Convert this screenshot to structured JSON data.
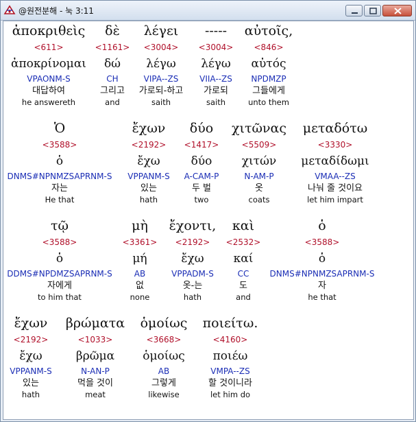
{
  "window": {
    "title": "@원전분해 - 눅 3:11"
  },
  "colors": {
    "strong": "#b0102a",
    "morph": "#1a2db5",
    "text": "#111111"
  },
  "rows": [
    {
      "words": [
        {
          "greek": "ἀποκριθεὶς",
          "strong": "<611>",
          "lemma": "ἀποκρίνομαι",
          "morph": "VPAONM-S",
          "korean": "대답하여",
          "english": "he answereth"
        },
        {
          "greek": "δὲ",
          "strong": "<1161>",
          "lemma": "δώ",
          "morph": "CH",
          "korean": "그리고",
          "english": "and"
        },
        {
          "greek": "λέγει",
          "strong": "<3004>",
          "lemma": "λέγω",
          "morph": "VIPA--ZS",
          "korean": "가로되-하고",
          "english": "saith"
        },
        {
          "greek": "-----",
          "strong": "<3004>",
          "lemma": "λέγω",
          "morph": "VIIA--ZS",
          "korean": "가로되",
          "english": "saith"
        },
        {
          "greek": "αὐτοῖς,",
          "strong": "<846>",
          "lemma": "αὐτός",
          "morph": "NPDMZP",
          "korean": "그들에게",
          "english": "unto them"
        }
      ]
    },
    {
      "words": [
        {
          "greek": "Ὁ",
          "strong": "<3588>",
          "lemma": "ὁ",
          "morph": "DNMS#NPNMZSAPRNM-S",
          "korean": "자는",
          "english": "He that"
        },
        {
          "greek": "ἔχων",
          "strong": "<2192>",
          "lemma": "ἔχω",
          "morph": "VPPANM-S",
          "korean": "있는",
          "english": "hath"
        },
        {
          "greek": "δύο",
          "strong": "<1417>",
          "lemma": "δύο",
          "morph": "A-CAM-P",
          "korean": "두 벌",
          "english": "two"
        },
        {
          "greek": "χιτῶνας",
          "strong": "<5509>",
          "lemma": "χιτών",
          "morph": "N-AM-P",
          "korean": "옷",
          "english": "coats"
        },
        {
          "greek": "μεταδότω",
          "strong": "<3330>",
          "lemma": "μεταδίδωμι",
          "morph": "VMAA--ZS",
          "korean": "나눠 줄 것이요",
          "english": "let him impart"
        }
      ]
    },
    {
      "words": [
        {
          "greek": "τῷ",
          "strong": "<3588>",
          "lemma": "ὁ",
          "morph": "DDMS#NPDMZSAPRNM-S",
          "korean": "자에게",
          "english": "to him that"
        },
        {
          "greek": "μὴ",
          "strong": "<3361>",
          "lemma": "μή",
          "morph": "AB",
          "korean": "없",
          "english": "none"
        },
        {
          "greek": "ἔχοντι,",
          "strong": "<2192>",
          "lemma": "ἔχω",
          "morph": "VPPADM-S",
          "korean": "옷-는",
          "english": "hath"
        },
        {
          "greek": "καὶ",
          "strong": "<2532>",
          "lemma": "καί",
          "morph": "CC",
          "korean": "도",
          "english": "and"
        },
        {
          "greek": "ὁ",
          "strong": "<3588>",
          "lemma": "ὁ",
          "morph": "DNMS#NPNMZSAPRNM-S",
          "korean": "자",
          "english": "he that"
        }
      ]
    },
    {
      "words": [
        {
          "greek": "ἔχων",
          "strong": "<2192>",
          "lemma": "ἔχω",
          "morph": "VPPANM-S",
          "korean": "있는",
          "english": "hath"
        },
        {
          "greek": "βρώματα",
          "strong": "<1033>",
          "lemma": "βρῶμα",
          "morph": "N-AN-P",
          "korean": "먹을 것이",
          "english": "meat"
        },
        {
          "greek": "ὁμοίως",
          "strong": "<3668>",
          "lemma": "ὁμοίως",
          "morph": "AB",
          "korean": "그렇게",
          "english": "likewise"
        },
        {
          "greek": "ποιείτω.",
          "strong": "<4160>",
          "lemma": "ποιέω",
          "morph": "VMPA--ZS",
          "korean": "할 것이니라",
          "english": "let him do"
        }
      ]
    }
  ]
}
